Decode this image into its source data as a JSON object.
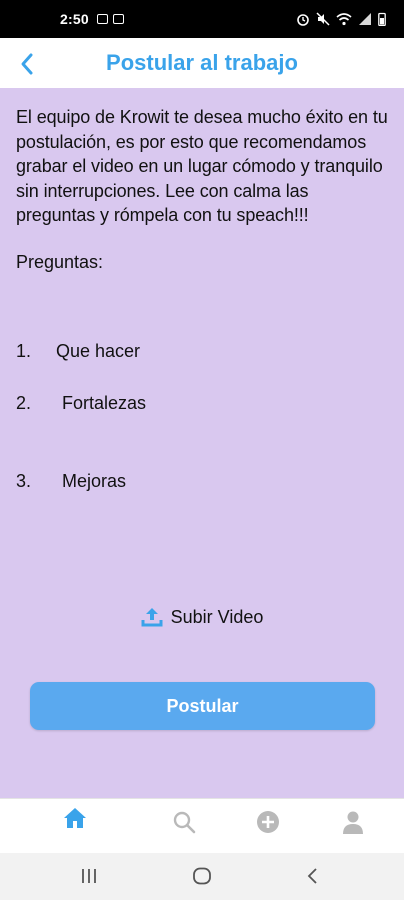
{
  "status_bar": {
    "time": "2:50"
  },
  "header": {
    "title": "Postular al trabajo"
  },
  "content": {
    "intro": "El equipo de Krowit te desea mucho éxito en tu postulación, es por esto que recomendamos grabar el video en un lugar cómodo y tranquilo sin interrupciones. Lee con calma las preguntas y rómpela con tu speach!!!",
    "questions_heading": "Preguntas:",
    "questions": [
      {
        "number": "1.",
        "text": "Que hacer"
      },
      {
        "number": "2.",
        "text": "Fortalezas"
      },
      {
        "number": "3.",
        "text": "Mejoras"
      }
    ],
    "upload_label": "Subir Video",
    "submit_label": "Postular"
  },
  "bottom_nav": {
    "items": [
      {
        "icon": "home-icon",
        "active": true
      },
      {
        "icon": "search-icon",
        "active": false
      },
      {
        "icon": "add-circle-icon",
        "active": false
      },
      {
        "icon": "profile-icon",
        "active": false
      }
    ]
  },
  "colors": {
    "accent": "#3aa3ea",
    "content_bg": "#d9c8ef",
    "button_bg": "#5aa9ef",
    "inactive_icon": "#b9b9b9"
  }
}
